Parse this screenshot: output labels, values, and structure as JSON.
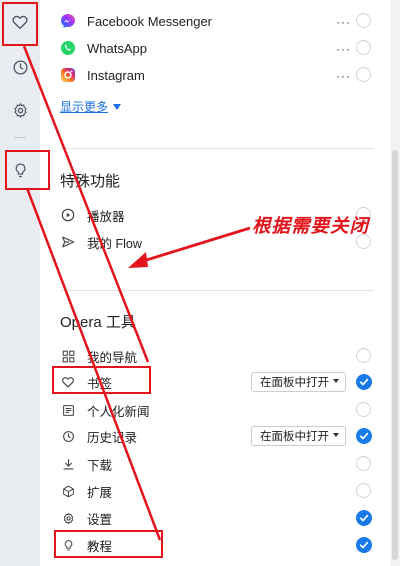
{
  "apps": [
    {
      "label": "Facebook Messenger",
      "icon": "messenger-icon",
      "more": "···"
    },
    {
      "label": "WhatsApp",
      "icon": "whatsapp-icon",
      "more": "···"
    },
    {
      "label": "Instagram",
      "icon": "instagram-icon",
      "more": "···"
    }
  ],
  "show_more": "显示更多",
  "special": {
    "heading": "特殊功能",
    "items": [
      {
        "label": "播放器",
        "icon": "play-circle-icon"
      },
      {
        "label": "我的 Flow",
        "icon": "send-icon"
      }
    ]
  },
  "tools": {
    "heading": "Opera 工具",
    "items": [
      {
        "label": "我的导航",
        "icon": "grid-icon",
        "checked": false
      },
      {
        "label": "书签",
        "icon": "heart-icon",
        "checked": true,
        "select": "在面板中打开"
      },
      {
        "label": "个人化新闻",
        "icon": "news-icon",
        "checked": false
      },
      {
        "label": "历史记录",
        "icon": "clock-icon",
        "checked": true,
        "select": "在面板中打开"
      },
      {
        "label": "下载",
        "icon": "download-icon",
        "checked": false
      },
      {
        "label": "扩展",
        "icon": "cube-icon",
        "checked": false
      },
      {
        "label": "设置",
        "icon": "gear-icon",
        "checked": true
      },
      {
        "label": "教程",
        "icon": "lightbulb-icon",
        "checked": true
      }
    ]
  },
  "annotation": {
    "text": "根据需要关闭",
    "color": "#e3141b"
  },
  "colors": {
    "accent": "#1a7be8",
    "rail": "#e9edf2",
    "annotation": "#e3141b"
  }
}
